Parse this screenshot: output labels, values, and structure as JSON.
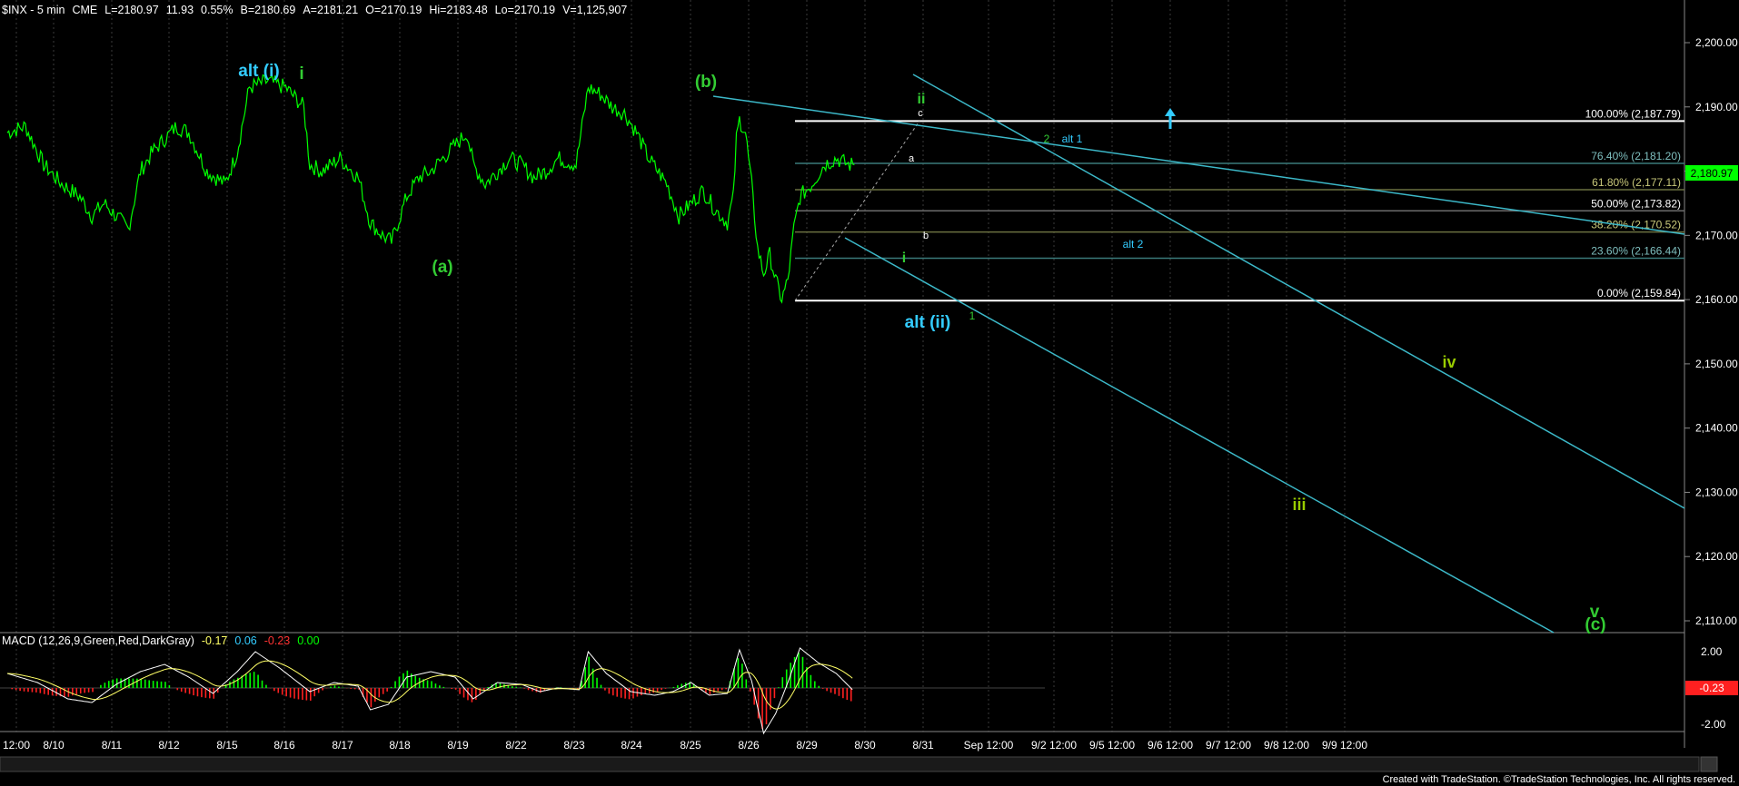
{
  "colors": {
    "background": "#000000",
    "price": "#00ff00",
    "axis_text": "#ffffff",
    "cyan_label": "#33ccff",
    "green_label": "#33cc33",
    "lime_label": "#99cc00",
    "trendline": "#3cb8c8",
    "fib_line": "#ffffff",
    "fib_mid": "#5d6d40",
    "fib_dark": "#3a7a7a",
    "macd_green": "#00ff00",
    "macd_red": "#ff2020",
    "macd_line": "#ffffff",
    "signal_line": "#ffff66",
    "last_price_bg": "#00ff00"
  },
  "header": {
    "symbol": "$INX - 5 min",
    "exchange": "CME",
    "last": "L=2180.97",
    "change": "11.93",
    "change_pct": "0.55%",
    "bid": "B=2180.69",
    "ask": "A=2181.21",
    "open": "O=2170.19",
    "high": "Hi=2183.48",
    "low": "Lo=2170.19",
    "volume": "V=1,125,907"
  },
  "macd_header": {
    "name": "MACD (12,26,9,Green,Red,DarkGray)",
    "v1": "-0.17",
    "v2": "0.06",
    "v3": "-0.23",
    "v4": "0.00"
  },
  "footer": "Created with TradeStation. ©TradeStation Technologies, Inc. All rights reserved.",
  "last_price_label": "2,180.97",
  "macd_last_label": "-0.23",
  "chart_data": {
    "type": "line",
    "title": "$INX - 5 min",
    "ylim": [
      2105,
      2205
    ],
    "y_ticks": [
      "2,110.00",
      "2,120.00",
      "2,130.00",
      "2,140.00",
      "2,150.00",
      "2,160.00",
      "2,170.00",
      "2,180.00",
      "2,190.00",
      "2,200.00"
    ],
    "x_ticks": [
      "12:00",
      "8/10",
      "8/11",
      "8/12",
      "8/15",
      "8/16",
      "8/17",
      "8/18",
      "8/19",
      "8/22",
      "8/23",
      "8/24",
      "8/25",
      "8/26",
      "8/29",
      "8/30",
      "8/31",
      "Sep 12:00",
      "9/2 12:00",
      "9/5 12:00",
      "9/6 12:00",
      "9/7 12:00",
      "9/8 12:00",
      "9/9 12:00"
    ],
    "price_anchors": [
      [
        0,
        2186
      ],
      [
        0.3,
        2187
      ],
      [
        0.6,
        2181
      ],
      [
        0.9,
        2178
      ],
      [
        1.2,
        2176
      ],
      [
        1.4,
        2173
      ],
      [
        1.6,
        2175
      ],
      [
        1.8,
        2173
      ],
      [
        2.0,
        2171
      ],
      [
        2.2,
        2180
      ],
      [
        2.4,
        2183
      ],
      [
        2.6,
        2185
      ],
      [
        2.8,
        2187
      ],
      [
        3.0,
        2186
      ],
      [
        3.3,
        2180
      ],
      [
        3.6,
        2178
      ],
      [
        3.8,
        2183
      ],
      [
        3.9,
        2188
      ],
      [
        4.0,
        2193
      ],
      [
        4.3,
        2194
      ],
      [
        4.6,
        2193
      ],
      [
        4.9,
        2190
      ],
      [
        5.0,
        2181
      ],
      [
        5.2,
        2180
      ],
      [
        5.5,
        2182
      ],
      [
        5.8,
        2179
      ],
      [
        6.0,
        2172
      ],
      [
        6.2,
        2170
      ],
      [
        6.35,
        2169
      ],
      [
        6.6,
        2176
      ],
      [
        6.8,
        2179
      ],
      [
        7.0,
        2180
      ],
      [
        7.2,
        2182
      ],
      [
        7.4,
        2184
      ],
      [
        7.6,
        2186
      ],
      [
        7.7,
        2181
      ],
      [
        7.9,
        2178
      ],
      [
        8.1,
        2180
      ],
      [
        8.3,
        2182
      ],
      [
        8.5,
        2181
      ],
      [
        8.7,
        2179
      ],
      [
        8.9,
        2180
      ],
      [
        9.1,
        2182
      ],
      [
        9.4,
        2181
      ],
      [
        9.55,
        2190
      ],
      [
        9.6,
        2193
      ],
      [
        9.8,
        2192
      ],
      [
        10.0,
        2190
      ],
      [
        10.2,
        2189
      ],
      [
        10.4,
        2186
      ],
      [
        10.6,
        2182
      ],
      [
        10.9,
        2178
      ],
      [
        11.1,
        2173
      ],
      [
        11.3,
        2175
      ],
      [
        11.5,
        2177
      ],
      [
        11.7,
        2174
      ],
      [
        11.9,
        2172
      ],
      [
        12.0,
        2176
      ],
      [
        12.05,
        2185
      ],
      [
        12.1,
        2188
      ],
      [
        12.2,
        2186
      ],
      [
        12.3,
        2178
      ],
      [
        12.4,
        2168
      ],
      [
        12.5,
        2164
      ],
      [
        12.6,
        2167
      ],
      [
        12.7,
        2163
      ],
      [
        12.8,
        2160
      ],
      [
        12.9,
        2163
      ],
      [
        13.0,
        2171
      ],
      [
        13.1,
        2176
      ],
      [
        13.3,
        2178
      ],
      [
        13.5,
        2181
      ],
      [
        13.7,
        2182
      ],
      [
        13.9,
        2181
      ],
      [
        14.0,
        2181
      ]
    ],
    "macd_ylim": [
      -3.2,
      3.2
    ],
    "macd_anchors": [
      [
        0,
        0.8
      ],
      [
        0.5,
        0.3
      ],
      [
        1.0,
        -0.6
      ],
      [
        1.4,
        -0.8
      ],
      [
        1.8,
        0.2
      ],
      [
        2.2,
        0.9
      ],
      [
        2.6,
        1.3
      ],
      [
        3.0,
        0.6
      ],
      [
        3.4,
        -0.3
      ],
      [
        3.8,
        0.9
      ],
      [
        4.1,
        2.0
      ],
      [
        4.5,
        1.1
      ],
      [
        5.0,
        -0.2
      ],
      [
        5.4,
        0.3
      ],
      [
        5.8,
        0.1
      ],
      [
        6.0,
        -1.2
      ],
      [
        6.3,
        -0.9
      ],
      [
        6.6,
        0.6
      ],
      [
        7.0,
        0.9
      ],
      [
        7.4,
        0.6
      ],
      [
        7.7,
        -0.6
      ],
      [
        8.1,
        0.3
      ],
      [
        8.5,
        0.2
      ],
      [
        8.8,
        -0.2
      ],
      [
        9.1,
        0.0
      ],
      [
        9.45,
        -0.1
      ],
      [
        9.6,
        2.0
      ],
      [
        9.9,
        0.8
      ],
      [
        10.3,
        -0.2
      ],
      [
        10.7,
        -0.4
      ],
      [
        11.0,
        -0.2
      ],
      [
        11.3,
        0.3
      ],
      [
        11.6,
        -0.4
      ],
      [
        11.9,
        -0.3
      ],
      [
        12.1,
        2.1
      ],
      [
        12.3,
        0.4
      ],
      [
        12.5,
        -2.5
      ],
      [
        12.7,
        -1.4
      ],
      [
        12.9,
        0.3
      ],
      [
        13.1,
        2.2
      ],
      [
        13.4,
        1.4
      ],
      [
        13.7,
        0.8
      ],
      [
        14.0,
        -0.2
      ]
    ],
    "fib_levels": [
      {
        "label": "100.00% (2,187.79)",
        "value": 2187.79
      },
      {
        "label": "76.40% (2,181.20)",
        "value": 2181.2
      },
      {
        "label": "61.80% (2,177.11)",
        "value": 2177.11
      },
      {
        "label": "50.00% (2,173.82)",
        "value": 2173.82
      },
      {
        "label": "38.20% (2,170.52)",
        "value": 2170.52
      },
      {
        "label": "23.60% (2,166.44)",
        "value": 2166.44
      },
      {
        "label": "0.00% (2,159.84)",
        "value": 2159.84
      }
    ],
    "annotations": [
      {
        "text": "alt (i)",
        "style": "cyan_big"
      },
      {
        "text": "i",
        "style": "green_big"
      },
      {
        "text": "(a)",
        "style": "green_big"
      },
      {
        "text": "(b)",
        "style": "green_big"
      },
      {
        "text": "ii",
        "style": "green_med"
      },
      {
        "text": "c",
        "style": "white_small"
      },
      {
        "text": "a",
        "style": "white_small"
      },
      {
        "text": "b",
        "style": "white_small"
      },
      {
        "text": "i",
        "style": "green_med"
      },
      {
        "text": "alt (ii)",
        "style": "cyan_big"
      },
      {
        "text": "1",
        "style": "green_small"
      },
      {
        "text": "2",
        "style": "green_small"
      },
      {
        "text": "alt 1",
        "style": "cyan_small"
      },
      {
        "text": "alt 2",
        "style": "cyan_small"
      },
      {
        "text": "iv",
        "style": "lime_big"
      },
      {
        "text": "iii",
        "style": "lime_big"
      },
      {
        "text": "v",
        "style": "green_big"
      },
      {
        "text": "(c)",
        "style": "green_big"
      }
    ]
  }
}
